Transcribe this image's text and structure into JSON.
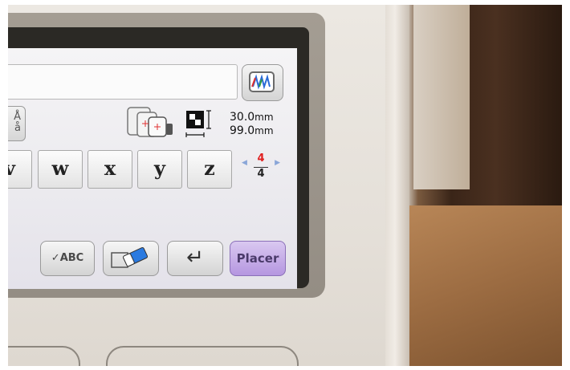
{
  "screen": {
    "charset_button": {
      "upper": "Å",
      "lower": "å"
    },
    "dimensions": {
      "height": "30.0",
      "width": "99.0",
      "unit": "mm"
    },
    "keys": [
      "v",
      "w",
      "x",
      "y",
      "z"
    ],
    "page": {
      "current": "4",
      "total": "4"
    },
    "buttons": {
      "check_label": "✓ABC",
      "enter_symbol": "↵",
      "placer_label": "Placer"
    },
    "icons": {
      "color_button": "thread-color-icon",
      "hoop": "embroidery-hoop-icon",
      "size": "design-size-icon",
      "erase": "eraser-icon"
    },
    "colors": {
      "placer_accent": "#b596e0",
      "page_current": "#e02020"
    }
  }
}
